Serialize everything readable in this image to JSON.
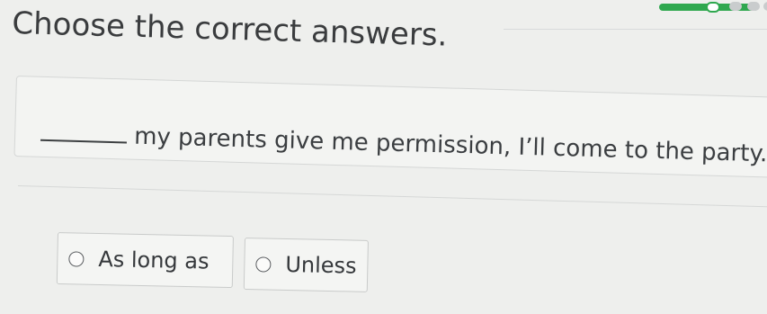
{
  "quiz": {
    "title": "Choose the correct answers.",
    "question": {
      "sentence": "my parents give me permission, I’ll come to the party."
    },
    "options": [
      {
        "label": "As long as",
        "selected": false
      },
      {
        "label": "Unless",
        "selected": false
      }
    ]
  },
  "colors": {
    "progress": "#2fa84f",
    "background": "#eeefed",
    "card": "#f3f4f2"
  }
}
